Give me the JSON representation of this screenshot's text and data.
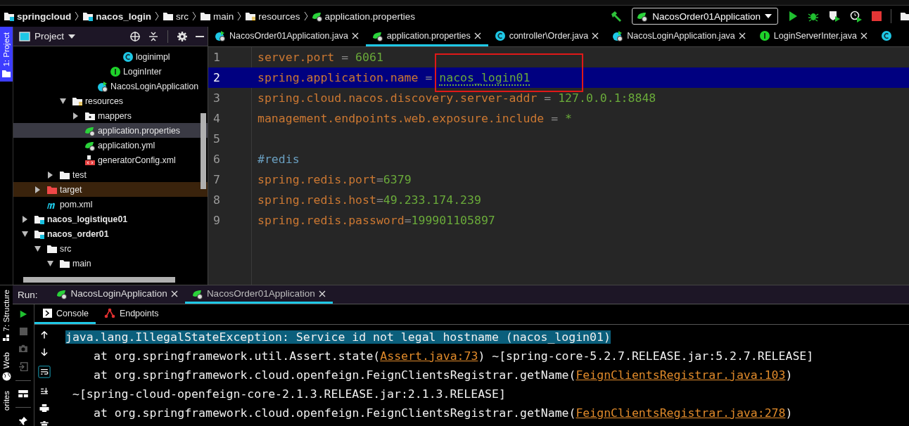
{
  "breadcrumb": [
    {
      "label": "springcloud",
      "kind": "module"
    },
    {
      "label": "nacos_login",
      "kind": "module"
    },
    {
      "label": "src",
      "kind": "folder"
    },
    {
      "label": "main",
      "kind": "folder"
    },
    {
      "label": "resources",
      "kind": "resources"
    },
    {
      "label": "application.properties",
      "kind": "spring-config"
    }
  ],
  "run_config": {
    "label": "NacosOrder01Application"
  },
  "side_tabs": [
    {
      "label": "1: Project",
      "selected": true
    }
  ],
  "project_panel": {
    "title": "Project"
  },
  "tree": {
    "items": [
      {
        "children": [
          {
            "children": [
              {
                "children": [
                  {
                    "children": [
                      {
                        "children": [
                          {
                            "children": [
                              {
                                "children": [
                                  {
                                    "label": "loginimpl",
                                    "kind": "class",
                                    "selected": false
                                  }
                                ]
                              },
                              {
                                "label": "LoginInter",
                                "kind": "interface",
                                "selected": false
                              }
                            ]
                          },
                          {
                            "label": "NacosLoginApplication",
                            "kind": "spring-class",
                            "selected": false
                          }
                        ]
                      }
                    ]
                  },
                  {
                    "label": "resources",
                    "kind": "resources",
                    "expanded": true,
                    "selected": false,
                    "children": [
                      {
                        "label": "mappers",
                        "kind": "package",
                        "expanded": false,
                        "selected": false
                      },
                      {
                        "label": "application.properties",
                        "kind": "spring-config",
                        "selected": true
                      },
                      {
                        "label": "application.yml",
                        "kind": "spring-config",
                        "selected": false
                      },
                      {
                        "label": "generatorConfig.xml",
                        "kind": "xml",
                        "selected": false
                      }
                    ]
                  }
                ]
              },
              {
                "label": "test",
                "kind": "folder",
                "expanded": false,
                "selected": false
              }
            ]
          },
          {
            "label": "target",
            "kind": "excluded-folder",
            "expanded": false,
            "selected": false
          },
          {
            "label": "pom.xml",
            "kind": "maven",
            "selected": false
          }
        ]
      },
      {
        "label": "nacos_logistique01",
        "kind": "module",
        "expanded": false,
        "selected": false
      },
      {
        "label": "nacos_order01",
        "kind": "module",
        "expanded": true,
        "selected": false,
        "children": [
          {
            "label": "src",
            "kind": "folder",
            "expanded": true,
            "selected": false,
            "children": [
              {
                "label": "main",
                "kind": "folder",
                "expanded": true,
                "selected": false
              }
            ]
          }
        ]
      }
    ]
  },
  "editor_tabs": [
    {
      "label": "NacosOrder01Application.java",
      "kind": "spring-class",
      "selected": false
    },
    {
      "label": "application.properties",
      "kind": "spring-config",
      "selected": true
    },
    {
      "label": "controller\\Order.java",
      "kind": "class",
      "selected": false
    },
    {
      "label": "NacosLoginApplication.java",
      "kind": "spring-class",
      "selected": false
    },
    {
      "label": "LoginServerInter.java",
      "kind": "interface",
      "selected": false
    },
    {
      "kind": "class",
      "selected": false
    }
  ],
  "code_lines": [
    {
      "number": "1",
      "kind": "property",
      "key": "server.port",
      "sep": " = ",
      "value": "6061",
      "selected": false,
      "misspelled": false
    },
    {
      "number": "2",
      "kind": "property",
      "key": "spring.application.name",
      "sep": " = ",
      "value": "nacos_login01",
      "selected": true,
      "misspelled": true
    },
    {
      "number": "3",
      "kind": "property",
      "key": "spring.cloud.nacos.discovery.server-addr",
      "sep": " = ",
      "value": "127.0.0.1:8848",
      "selected": false,
      "misspelled": false
    },
    {
      "number": "4",
      "kind": "property",
      "key": "management.endpoints.web.exposure.include",
      "sep": " = ",
      "value": "*",
      "selected": false,
      "misspelled": false
    },
    {
      "number": "5",
      "kind": "blank",
      "selected": false
    },
    {
      "number": "6",
      "kind": "comment",
      "text": "#redis",
      "selected": false
    },
    {
      "number": "7",
      "kind": "property",
      "key": "spring.redis.port",
      "sep": "=",
      "value": "6379",
      "selected": false,
      "misspelled": false
    },
    {
      "number": "8",
      "kind": "property",
      "key": "spring.redis.host",
      "sep": "=",
      "value": "49.233.174.239",
      "selected": false,
      "misspelled": false
    },
    {
      "number": "9",
      "kind": "property",
      "key": "spring.redis.password",
      "sep": "=",
      "value": "199901105897",
      "selected": false,
      "misspelled": false
    }
  ],
  "run_panel": {
    "label": "Run:",
    "tabs": [
      {
        "label": "NacosLoginApplication",
        "selected": false
      },
      {
        "label": "NacosOrder01Application",
        "selected": true
      }
    ],
    "sub_tabs": [
      {
        "label": "Console",
        "kind": "console",
        "selected": true
      },
      {
        "label": "Endpoints",
        "kind": "endpoints",
        "selected": false
      }
    ],
    "console_lines": [
      {
        "kind": "exception",
        "segments": [
          {
            "text": "java.lang.IllegalStateException: Service id not legal hostname (nacos_login01)",
            "kind": "highlight"
          }
        ]
      },
      {
        "kind": "frame",
        "segments": [
          {
            "text": "at org.springframework.util.Assert.state(",
            "kind": "plain"
          },
          {
            "text": "Assert.java:73",
            "kind": "link"
          },
          {
            "text": ") ~[spring-core-5.2.7.RELEASE.jar:5.2.7.RELEASE]",
            "kind": "plain"
          }
        ]
      },
      {
        "kind": "frame",
        "segments": [
          {
            "text": "at org.springframework.cloud.openfeign.FeignClientsRegistrar.getName(",
            "kind": "plain"
          },
          {
            "text": "FeignClientsRegistrar.java:103",
            "kind": "link"
          },
          {
            "text": ")",
            "kind": "plain"
          }
        ]
      },
      {
        "kind": "continuation",
        "segments": [
          {
            "text": "~[spring-cloud-openfeign-core-2.1.3.RELEASE.jar:2.1.3.RELEASE]",
            "kind": "plain"
          }
        ]
      },
      {
        "kind": "frame",
        "segments": [
          {
            "text": "at org.springframework.cloud.openfeign.FeignClientsRegistrar.getName(",
            "kind": "plain"
          },
          {
            "text": "FeignClientsRegistrar.java:278",
            "kind": "link"
          },
          {
            "text": ")",
            "kind": "plain"
          }
        ]
      }
    ]
  },
  "bottom_side_tabs": [
    {
      "label": "7: Structure",
      "kind": "structure"
    },
    {
      "label": "Web",
      "kind": "web"
    },
    {
      "label": "orites",
      "kind": "favorites"
    }
  ]
}
